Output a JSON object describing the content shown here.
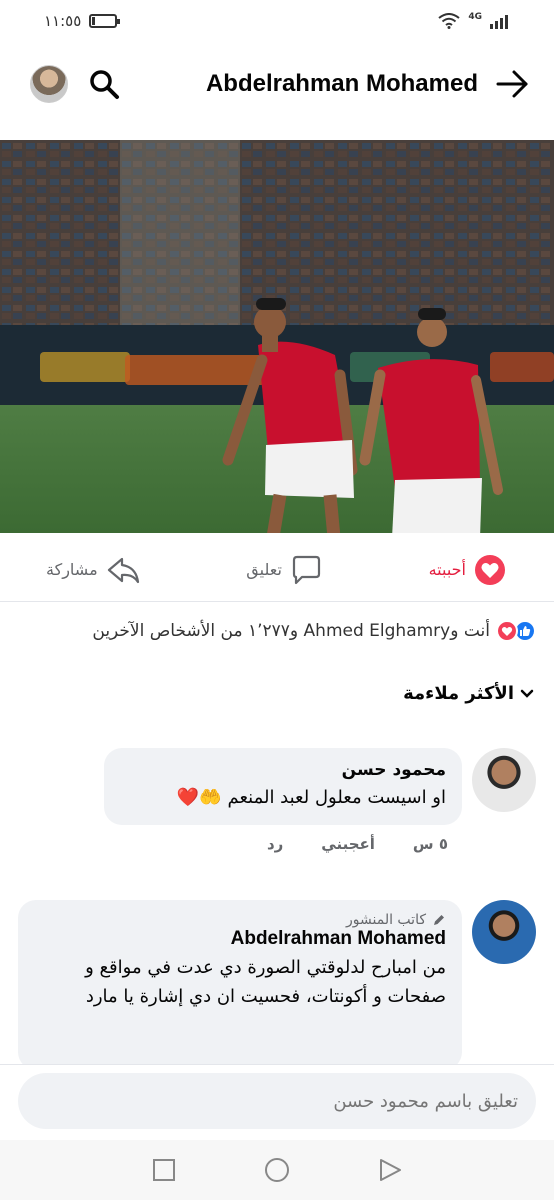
{
  "status_bar": {
    "time": "١١:٥٥",
    "network": "4G"
  },
  "header": {
    "title": "Abdelrahman Mohamed"
  },
  "actions": {
    "like": "أحببته",
    "comment": "تعليق",
    "share": "مشاركة"
  },
  "reactions": {
    "summary": "أنت وAhmed Elghamry و١٬٢٧٧ من الأشخاص الآخرين"
  },
  "sort": {
    "label": "الأكثر ملاءمة"
  },
  "comments": [
    {
      "name": "محمود حسن",
      "text": "او اسيست معلول لعبد المنعم 🤲❤️",
      "time": "٥ س",
      "like_label": "أعجبني",
      "reply_label": "رد"
    },
    {
      "author_tag": "كاتب المنشور",
      "name": "Abdelrahman Mohamed",
      "text": "من امبارح لدلوقتي الصورة دي عدت في مواقع و صفحات و أكونتات، فحسيت ان دي إشارة يا مارد"
    }
  ],
  "composer": {
    "placeholder": "تعليق باسم محمود حسن"
  },
  "colors": {
    "like_red": "#e41e3f",
    "like_blue": "#1877f2",
    "bubble_bg": "#f0f2f5",
    "jersey_red": "#c8102e"
  }
}
